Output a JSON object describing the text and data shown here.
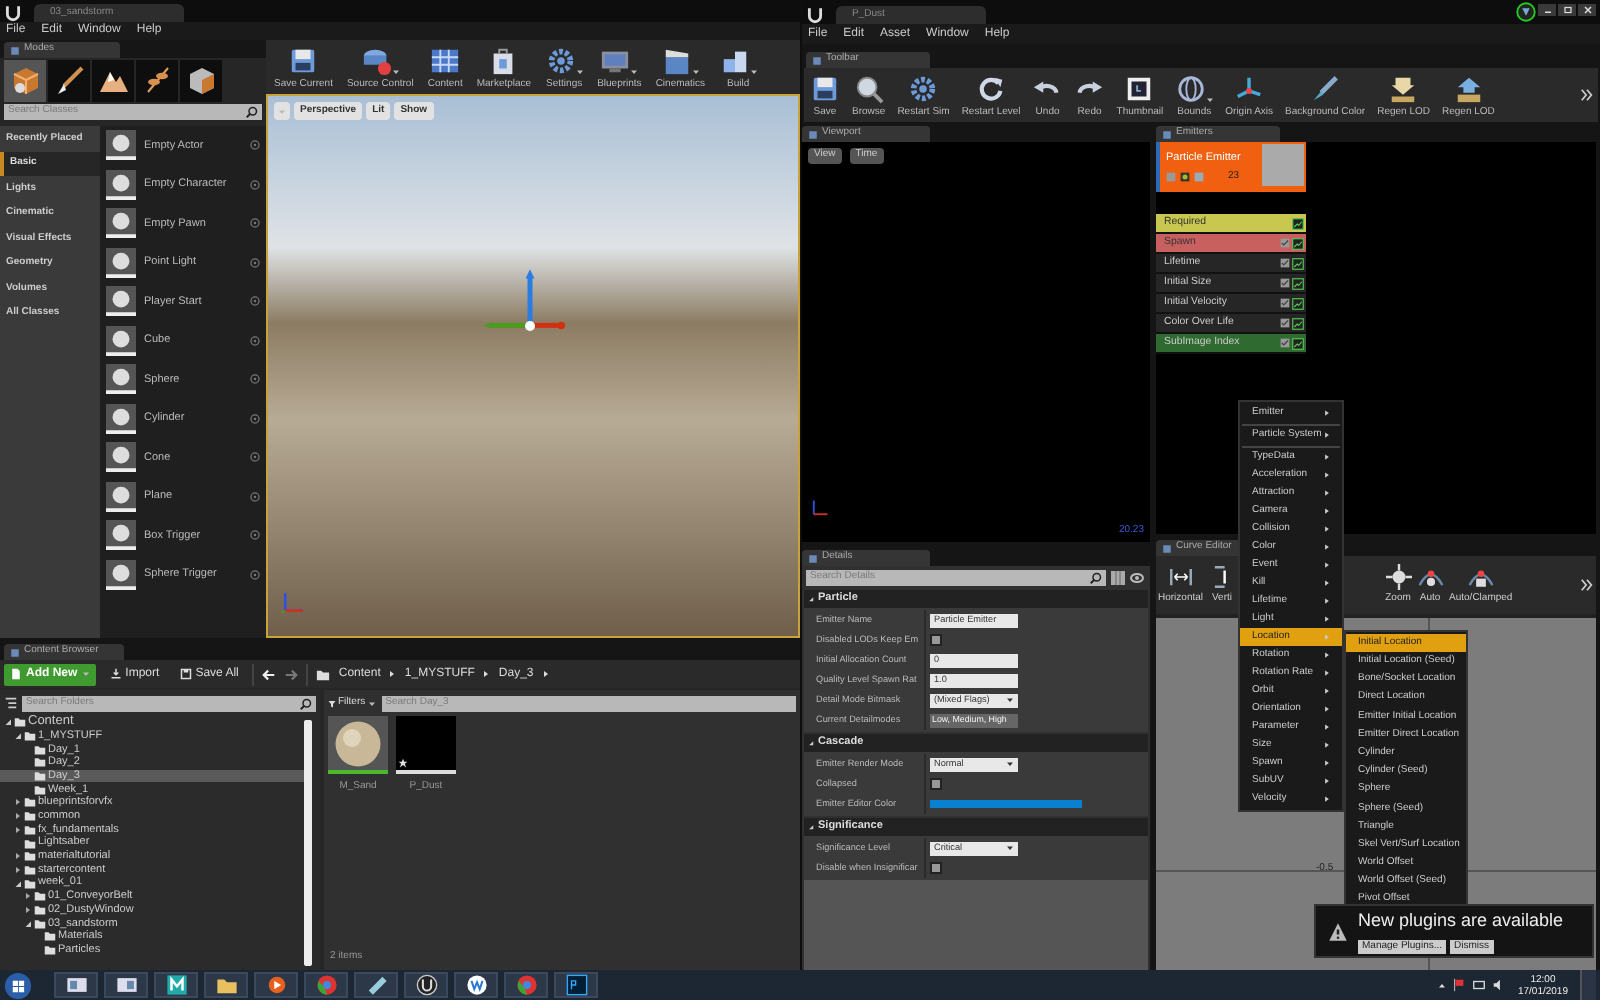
{
  "level_editor": {
    "tab_title": "03_sandstorm",
    "menu": [
      "File",
      "Edit",
      "Window",
      "Help"
    ],
    "modes": {
      "tab": "Modes",
      "mode_tabs": [
        {
          "kind": "place",
          "selected": true
        },
        {
          "kind": "paint",
          "selected": false
        },
        {
          "kind": "landscape",
          "selected": false
        },
        {
          "kind": "foliage",
          "selected": false
        },
        {
          "kind": "mesh",
          "selected": false
        }
      ],
      "search_placeholder": "Search Classes",
      "categories": [
        {
          "label": "Recently Placed",
          "selected": false
        },
        {
          "label": "Basic",
          "selected": true
        },
        {
          "label": "Lights",
          "selected": false
        },
        {
          "label": "Cinematic",
          "selected": false
        },
        {
          "label": "Visual Effects",
          "selected": false
        },
        {
          "label": "Geometry",
          "selected": false
        },
        {
          "label": "Volumes",
          "selected": false
        },
        {
          "label": "All Classes",
          "selected": false
        }
      ],
      "items": [
        "Empty Actor",
        "Empty Character",
        "Empty Pawn",
        "Point Light",
        "Player Start",
        "Cube",
        "Sphere",
        "Cylinder",
        "Cone",
        "Plane",
        "Box Trigger",
        "Sphere Trigger"
      ]
    },
    "toolbar": [
      {
        "label": "Save Current",
        "kind": "save",
        "dropdown": false
      },
      {
        "label": "Source Control",
        "kind": "source",
        "dropdown": true
      },
      {
        "label": "Content",
        "kind": "content",
        "dropdown": false
      },
      {
        "label": "Marketplace",
        "kind": "market",
        "dropdown": false
      },
      {
        "label": "Settings",
        "kind": "settings",
        "dropdown": true
      },
      {
        "label": "Blueprints",
        "kind": "blueprints",
        "dropdown": true
      },
      {
        "label": "Cinematics",
        "kind": "cinematics",
        "dropdown": true
      },
      {
        "label": "Build",
        "kind": "build",
        "dropdown": true
      }
    ],
    "viewport": {
      "buttons": [
        "Perspective",
        "Lit",
        "Show"
      ]
    }
  },
  "content_browser": {
    "tab": "Content Browser",
    "add_new": "Add New",
    "import": "Import",
    "save_all": "Save All",
    "breadcrumbs": [
      "Content",
      "1_MYSTUFF",
      "Day_3"
    ],
    "folder_search_placeholder": "Search Folders",
    "filters": "Filters",
    "asset_search_placeholder": "Search Day_3",
    "tree": [
      {
        "label": "Content",
        "expandable": true,
        "expanded": true,
        "selected": false,
        "children": [
          {
            "label": "1_MYSTUFF",
            "expandable": true,
            "expanded": true,
            "selected": false,
            "children": [
              {
                "label": "Day_1",
                "expandable": false,
                "expanded": false,
                "selected": false
              },
              {
                "label": "Day_2",
                "expandable": false,
                "expanded": false,
                "selected": false
              },
              {
                "label": "Day_3",
                "expandable": false,
                "expanded": false,
                "selected": true
              },
              {
                "label": "Week_1",
                "expandable": false,
                "expanded": false,
                "selected": false
              }
            ]
          },
          {
            "label": "blueprintsforvfx",
            "expandable": true,
            "expanded": false,
            "selected": false
          },
          {
            "label": "common",
            "expandable": true,
            "expanded": false,
            "selected": false
          },
          {
            "label": "fx_fundamentals",
            "expandable": true,
            "expanded": false,
            "selected": false
          },
          {
            "label": "Lightsaber",
            "expandable": false,
            "expanded": false,
            "selected": false
          },
          {
            "label": "materialtutorial",
            "expandable": true,
            "expanded": false,
            "selected": false
          },
          {
            "label": "startercontent",
            "expandable": true,
            "expanded": false,
            "selected": false
          },
          {
            "label": "week_01",
            "expandable": true,
            "expanded": true,
            "selected": false,
            "children": [
              {
                "label": "01_ConveyorBelt",
                "expandable": true,
                "expanded": false,
                "selected": false
              },
              {
                "label": "02_DustyWindow",
                "expandable": true,
                "expanded": false,
                "selected": false
              },
              {
                "label": "03_sandstorm",
                "expandable": true,
                "expanded": true,
                "selected": false,
                "children": [
                  {
                    "label": "Materials",
                    "expandable": false,
                    "expanded": false,
                    "selected": false
                  },
                  {
                    "label": "Particles",
                    "expandable": false,
                    "expanded": false,
                    "selected": false
                  }
                ]
              }
            ]
          }
        ]
      }
    ],
    "assets": [
      {
        "name": "M_Sand",
        "kind": "material"
      },
      {
        "name": "P_Dust",
        "kind": "particle"
      }
    ],
    "item_count": "2 items"
  },
  "cascade_editor": {
    "tab_title": "P_Dust",
    "menu": [
      "File",
      "Edit",
      "Asset",
      "Window",
      "Help"
    ],
    "toolbar_tab": "Toolbar",
    "toolbar": [
      {
        "label": "Save",
        "kind": "save",
        "dropdown": false
      },
      {
        "label": "Browse",
        "kind": "browse",
        "dropdown": false
      },
      {
        "label": "Restart Sim",
        "kind": "settings",
        "dropdown": false
      },
      {
        "label": "Restart Level",
        "kind": "restart",
        "dropdown": false
      },
      {
        "label": "Undo",
        "kind": "undo",
        "dropdown": false
      },
      {
        "label": "Redo",
        "kind": "redo",
        "dropdown": false
      },
      {
        "label": "Thumbnail",
        "kind": "thumbnail",
        "dropdown": false
      },
      {
        "label": "Bounds",
        "kind": "bounds",
        "dropdown": true
      },
      {
        "label": "Origin Axis",
        "kind": "axis",
        "dropdown": false
      },
      {
        "label": "Background Color",
        "kind": "brush",
        "dropdown": false
      },
      {
        "label": "Regen LOD",
        "kind": "lod",
        "dropdown": false
      },
      {
        "label": "Regen LOD",
        "kind": "lod2",
        "dropdown": false
      }
    ],
    "viewport": {
      "tab": "Viewport",
      "buttons": [
        "View",
        "Time"
      ],
      "reading": "20.23"
    },
    "emitters": {
      "tab": "Emitters",
      "emitter_name": "Particle Emitter",
      "emitter_count": "23",
      "modules": [
        {
          "name": "Required",
          "kind": "required",
          "selected": false
        },
        {
          "name": "Spawn",
          "kind": "spawn",
          "selected": false
        },
        {
          "name": "Lifetime",
          "kind": "module",
          "selected": false
        },
        {
          "name": "Initial Size",
          "kind": "module",
          "selected": false
        },
        {
          "name": "Initial Velocity",
          "kind": "module",
          "selected": false
        },
        {
          "name": "Color Over Life",
          "kind": "module",
          "selected": false
        },
        {
          "name": "SubImage Index",
          "kind": "module",
          "selected": true
        }
      ]
    },
    "details": {
      "tab": "Details",
      "search_placeholder": "Search Details",
      "sections": [
        {
          "title": "Particle",
          "properties": [
            {
              "label": "Emitter Name",
              "kind": "text",
              "value": "Particle Emitter"
            },
            {
              "label": "Disabled LODs Keep Em",
              "kind": "checkbox",
              "checked": false
            },
            {
              "label": "Initial Allocation Count",
              "kind": "number",
              "value": "0"
            },
            {
              "label": "Quality Level Spawn Rat",
              "kind": "number",
              "value": "1.0"
            },
            {
              "label": "Detail Mode Bitmask",
              "kind": "dropdown",
              "value": "(Mixed Flags)"
            },
            {
              "label": "Current Detailmodes",
              "kind": "readonly",
              "value": "Low, Medium, High"
            }
          ]
        },
        {
          "title": "Cascade",
          "properties": [
            {
              "label": "Emitter Render Mode",
              "kind": "dropdown",
              "value": "Normal"
            },
            {
              "label": "Collapsed",
              "kind": "checkbox",
              "checked": false
            },
            {
              "label": "Emitter Editor Color",
              "kind": "color",
              "color": "#0a80d0"
            }
          ]
        },
        {
          "title": "Significance",
          "properties": [
            {
              "label": "Significance Level",
              "kind": "dropdown",
              "value": "Critical"
            },
            {
              "label": "Disable when Insignificar",
              "kind": "checkbox",
              "checked": false
            }
          ]
        }
      ]
    },
    "curve_editor": {
      "tab": "Curve Editor",
      "buttons": [
        {
          "label": "Horizontal",
          "kind": "horizontal"
        },
        {
          "label": "Verti",
          "kind": "vertical"
        },
        {
          "label": "Zoom",
          "kind": "zoom"
        },
        {
          "label": "Auto",
          "kind": "auto"
        },
        {
          "label": "Auto/Clamped",
          "kind": "clamped"
        }
      ],
      "axis_label": "-0.5"
    },
    "context_menu": {
      "items": [
        {
          "label": "Emitter",
          "divider_after": true,
          "selected": false
        },
        {
          "label": "Particle System",
          "divider_after": true,
          "selected": false
        },
        {
          "label": "TypeData",
          "divider_after": false,
          "selected": false
        },
        {
          "label": "Acceleration",
          "divider_after": false,
          "selected": false
        },
        {
          "label": "Attraction",
          "divider_after": false,
          "selected": false
        },
        {
          "label": "Camera",
          "divider_after": false,
          "selected": false
        },
        {
          "label": "Collision",
          "divider_after": false,
          "selected": false
        },
        {
          "label": "Color",
          "divider_after": false,
          "selected": false
        },
        {
          "label": "Event",
          "divider_after": false,
          "selected": false
        },
        {
          "label": "Kill",
          "divider_after": false,
          "selected": false
        },
        {
          "label": "Lifetime",
          "divider_after": false,
          "selected": false
        },
        {
          "label": "Light",
          "divider_after": false,
          "selected": false
        },
        {
          "label": "Location",
          "divider_after": false,
          "selected": true
        },
        {
          "label": "Rotation",
          "divider_after": false,
          "selected": false
        },
        {
          "label": "Rotation Rate",
          "divider_after": false,
          "selected": false
        },
        {
          "label": "Orbit",
          "divider_after": false,
          "selected": false
        },
        {
          "label": "Orientation",
          "divider_after": false,
          "selected": false
        },
        {
          "label": "Parameter",
          "divider_after": false,
          "selected": false
        },
        {
          "label": "Size",
          "divider_after": false,
          "selected": false
        },
        {
          "label": "Spawn",
          "divider_after": false,
          "selected": false
        },
        {
          "label": "SubUV",
          "divider_after": false,
          "selected": false
        },
        {
          "label": "Velocity",
          "divider_after": false,
          "selected": false
        }
      ],
      "submenu": [
        {
          "label": "Initial Location",
          "selected": true
        },
        {
          "label": "Initial Location (Seed)",
          "selected": false
        },
        {
          "label": "Bone/Socket Location",
          "selected": false
        },
        {
          "label": "Direct Location",
          "selected": false
        },
        {
          "label": "Emitter Initial Location",
          "selected": false
        },
        {
          "label": "Emitter Direct Location",
          "selected": false
        },
        {
          "label": "Cylinder",
          "selected": false
        },
        {
          "label": "Cylinder (Seed)",
          "selected": false
        },
        {
          "label": "Sphere",
          "selected": false
        },
        {
          "label": "Sphere (Seed)",
          "selected": false
        },
        {
          "label": "Triangle",
          "selected": false
        },
        {
          "label": "Skel Vert/Surf Location",
          "selected": false
        },
        {
          "label": "World Offset",
          "selected": false
        },
        {
          "label": "World Offset (Seed)",
          "selected": false
        },
        {
          "label": "Pivot Offset",
          "selected": false
        }
      ]
    },
    "notification": {
      "message": "New plugins are available",
      "buttons": [
        "Manage Plugins...",
        "Dismiss"
      ]
    }
  },
  "taskbar": {
    "time": "12:00",
    "date": "17/01/2019"
  }
}
